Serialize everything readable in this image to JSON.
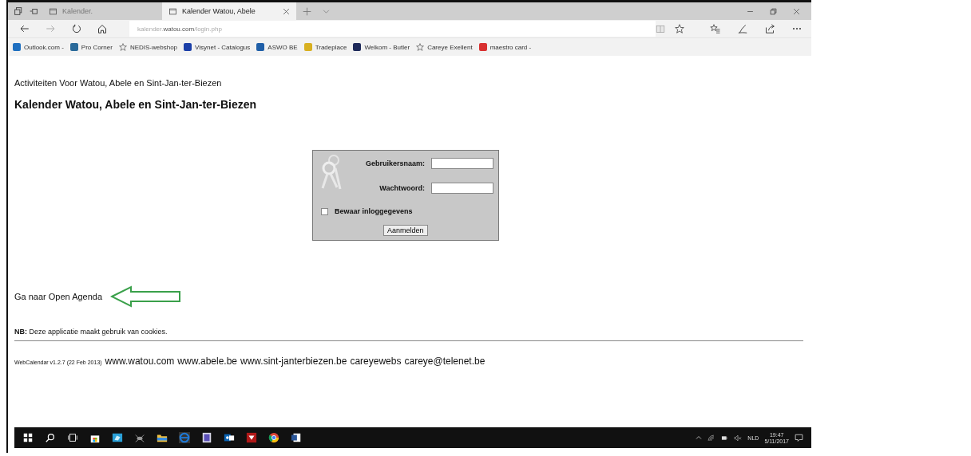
{
  "browser": {
    "tabs": [
      {
        "label": "Kalender.",
        "selected": false
      },
      {
        "label": "Kalender Watou, Abele",
        "selected": true
      }
    ],
    "address": {
      "prefix": "kalender.",
      "domain": "watou.com",
      "path": "/login.php"
    },
    "favorites": [
      {
        "label": "Outlook.com -",
        "kind": "site",
        "color": "#1e6fc0"
      },
      {
        "label": "Pro Corner",
        "kind": "site",
        "color": "#2a6a9a"
      },
      {
        "label": "NEDIS-webshop",
        "kind": "star"
      },
      {
        "label": "Visynet - Catalogus",
        "kind": "site",
        "color": "#1b3fa8"
      },
      {
        "label": "ASWO BE",
        "kind": "site",
        "color": "#1f5fa8"
      },
      {
        "label": "Tradeplace",
        "kind": "site",
        "color": "#d8b020"
      },
      {
        "label": "Welkom - Butler",
        "kind": "site",
        "color": "#1e2a5a"
      },
      {
        "label": "Careye Exellent",
        "kind": "star"
      },
      {
        "label": "maestro card -",
        "kind": "site",
        "color": "#d83030"
      }
    ]
  },
  "page": {
    "subtitle": "Activiteiten Voor Watou, Abele en Sint-Jan-ter-Biezen",
    "title": "Kalender Watou, Abele en Sint-Jan-ter-Biezen",
    "login": {
      "username_label": "Gebruikersnaam:",
      "password_label": "Wachtwoord:",
      "remember": {
        "label": "Bewaar inloggegevens",
        "checked": false
      },
      "button": "Aanmelden"
    },
    "agenda_link": "Ga naar Open Agenda",
    "note": "**NB:** Deze applicatie maakt gebruik van cookies.",
    "footer": {
      "version": "WebCalendar v1.2.7 (22 Feb 2013)",
      "links": [
        "www.watou.com",
        "www.abele.be",
        "www.sint-janterbiezen.be",
        "careyewebs",
        "careye@telenet.be"
      ]
    }
  },
  "taskbar": {
    "language": "NLD",
    "time": "19:47",
    "date": "5/11/2017"
  }
}
